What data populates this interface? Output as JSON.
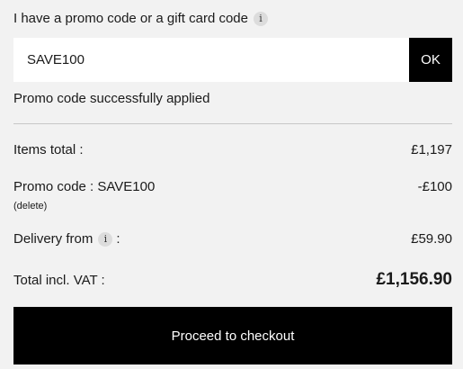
{
  "promo": {
    "heading": "I have a promo code or a gift card code",
    "info_icon": "i",
    "input_value": "SAVE100",
    "ok_label": "OK",
    "success_message": "Promo code successfully applied"
  },
  "summary": {
    "items_total_label": "Items total :",
    "items_total_value": "£1,197",
    "promo_label": "Promo code : SAVE100",
    "promo_value": "-£100",
    "delete_label": "(delete)",
    "delivery_label": "Delivery from",
    "delivery_info_icon": "i",
    "delivery_colon": ":",
    "delivery_value": "£59.90",
    "total_label": "Total incl. VAT :",
    "total_value": "£1,156.90"
  },
  "checkout": {
    "button_label": "Proceed to checkout"
  },
  "colors": {
    "background": "#f2f2f2",
    "button_bg": "#000000",
    "button_text": "#ffffff",
    "info_icon_bg": "#dcdcdc"
  },
  "icons": {
    "promo_info": "info-icon",
    "delivery_info": "info-icon"
  }
}
